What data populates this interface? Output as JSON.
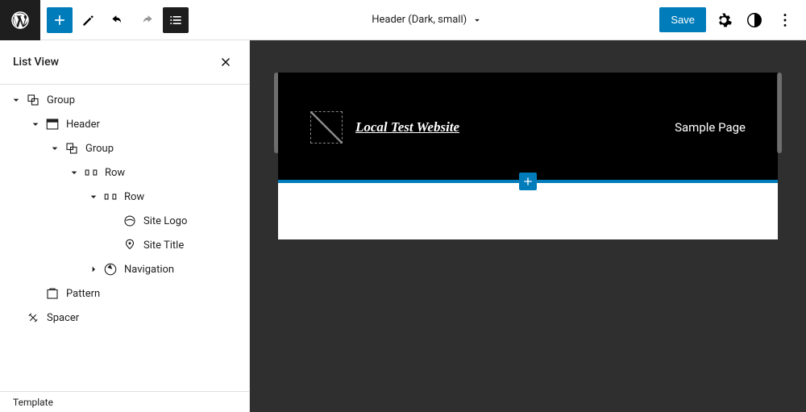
{
  "toolbar": {
    "template_name": "Header (Dark, small)",
    "save_label": "Save"
  },
  "list_panel": {
    "title": "List View",
    "tree": [
      {
        "label": "Group",
        "icon": "group",
        "level": 0,
        "toggle": "open"
      },
      {
        "label": "Header",
        "icon": "header",
        "level": 1,
        "toggle": "open"
      },
      {
        "label": "Group",
        "icon": "group",
        "level": 2,
        "toggle": "open"
      },
      {
        "label": "Row",
        "icon": "row",
        "level": 3,
        "toggle": "open"
      },
      {
        "label": "Row",
        "icon": "row",
        "level": 4,
        "toggle": "open"
      },
      {
        "label": "Site Logo",
        "icon": "sitelogo",
        "level": 5,
        "toggle": "none"
      },
      {
        "label": "Site Title",
        "icon": "sitetitle",
        "level": 5,
        "toggle": "none"
      },
      {
        "label": "Navigation",
        "icon": "navigation",
        "level": 4,
        "toggle": "closed"
      },
      {
        "label": "Pattern",
        "icon": "pattern",
        "level": 1,
        "toggle": "none"
      },
      {
        "label": "Spacer",
        "icon": "spacer",
        "level": 0,
        "toggle": "none"
      }
    ]
  },
  "footer": {
    "breadcrumb": "Template"
  },
  "canvas": {
    "site_title": "Local Test Website",
    "nav_item": "Sample Page"
  }
}
